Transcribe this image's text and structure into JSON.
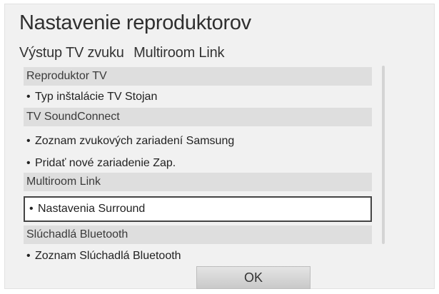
{
  "dialog": {
    "title": "Nastavenie reproduktorov",
    "tabs": [
      {
        "label": "Výstup TV zvuku"
      },
      {
        "label": "Multiroom Link"
      }
    ]
  },
  "list": {
    "sections": [
      {
        "header": "Reproduktor TV",
        "items": [
          "Typ inštalácie TV Stojan"
        ]
      },
      {
        "header": "TV SoundConnect",
        "items": [
          "Zoznam zvukových zariadení Samsung",
          "Pridať nové zariadenie Zap."
        ]
      },
      {
        "header": "Multiroom Link",
        "items": [
          "Nastavenia Surround"
        ]
      },
      {
        "header": "Slúchadlá Bluetooth",
        "items": [
          "Zoznam Slúchadlá Bluetooth"
        ]
      }
    ],
    "bullet": "•"
  },
  "buttons": {
    "ok_label": "OK"
  }
}
